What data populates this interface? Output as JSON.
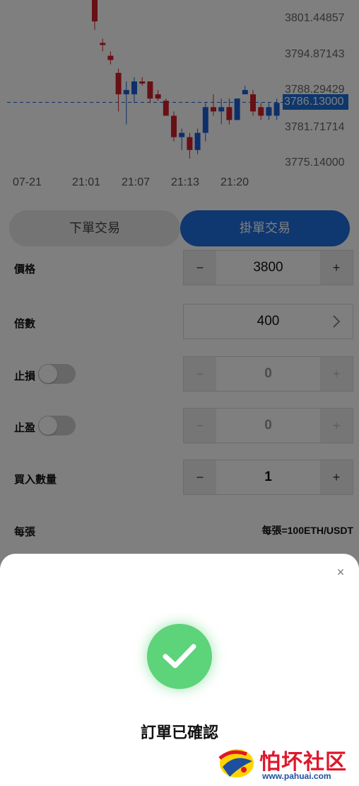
{
  "chart": {
    "price_labels": [
      "3801.44857",
      "3794.87143",
      "3788.29429",
      "3781.71714",
      "3775.14000"
    ],
    "current_price": "3786.13000",
    "time_labels": [
      "07-21",
      "21:01",
      "21:07",
      "21:13",
      "21:20"
    ],
    "up_color": "#1d5fd8",
    "down_color": "#d0202a",
    "chart_data": {
      "type": "candlestick",
      "y_range": [
        3772,
        3810
      ],
      "current_price": 3786.13,
      "candles": [
        {
          "o": 3810,
          "h": 3812,
          "l": 3803,
          "c": 3805
        },
        {
          "o": 3800,
          "h": 3801,
          "l": 3798,
          "c": 3799.5
        },
        {
          "o": 3797,
          "h": 3798,
          "l": 3795,
          "c": 3796
        },
        {
          "o": 3793,
          "h": 3794,
          "l": 3784,
          "c": 3788
        },
        {
          "o": 3788,
          "h": 3791,
          "l": 3781,
          "c": 3789
        },
        {
          "o": 3788,
          "h": 3792,
          "l": 3786,
          "c": 3791
        },
        {
          "o": 3791,
          "h": 3792,
          "l": 3790,
          "c": 3790.5
        },
        {
          "o": 3791,
          "h": 3791,
          "l": 3786,
          "c": 3787
        },
        {
          "o": 3788,
          "h": 3789,
          "l": 3786.5,
          "c": 3787
        },
        {
          "o": 3786.5,
          "h": 3787,
          "l": 3783,
          "c": 3783
        },
        {
          "o": 3783,
          "h": 3784,
          "l": 3777,
          "c": 3778
        },
        {
          "o": 3778,
          "h": 3780,
          "l": 3775,
          "c": 3779
        },
        {
          "o": 3778,
          "h": 3779,
          "l": 3773,
          "c": 3775
        },
        {
          "o": 3775,
          "h": 3780,
          "l": 3774,
          "c": 3779
        },
        {
          "o": 3779,
          "h": 3786,
          "l": 3777,
          "c": 3785
        },
        {
          "o": 3785,
          "h": 3788,
          "l": 3783,
          "c": 3784
        },
        {
          "o": 3784,
          "h": 3787,
          "l": 3781,
          "c": 3785
        },
        {
          "o": 3785,
          "h": 3787,
          "l": 3781,
          "c": 3782
        },
        {
          "o": 3782,
          "h": 3787,
          "l": 3782,
          "c": 3787
        },
        {
          "o": 3788,
          "h": 3790,
          "l": 3788,
          "c": 3789
        },
        {
          "o": 3788,
          "h": 3789,
          "l": 3783,
          "c": 3784
        },
        {
          "o": 3785,
          "h": 3786,
          "l": 3782,
          "c": 3783
        },
        {
          "o": 3783,
          "h": 3786,
          "l": 3782,
          "c": 3785
        },
        {
          "o": 3783,
          "h": 3787,
          "l": 3782,
          "c": 3786
        }
      ]
    }
  },
  "tabs": {
    "market": "下單交易",
    "limit": "掛單交易"
  },
  "form": {
    "price": {
      "label": "價格",
      "value": "3800",
      "minus": "−",
      "plus": "+"
    },
    "leverage": {
      "label": "倍數",
      "value": "400"
    },
    "stop_loss": {
      "label": "止損",
      "value": "0",
      "minus": "−",
      "plus": "+"
    },
    "take_profit": {
      "label": "止盈",
      "value": "0",
      "minus": "−",
      "plus": "+"
    },
    "quantity": {
      "label": "買入數量",
      "value": "1",
      "minus": "−",
      "plus": "+"
    },
    "per_unit": {
      "label": "每張",
      "value": "每張=100ETH/USDT"
    }
  },
  "dialog": {
    "close": "×",
    "message": "訂單已確認",
    "success_color": "#5dd37a"
  },
  "watermark": {
    "brand": "怕坏社区",
    "url": "www.pahuai.com"
  }
}
